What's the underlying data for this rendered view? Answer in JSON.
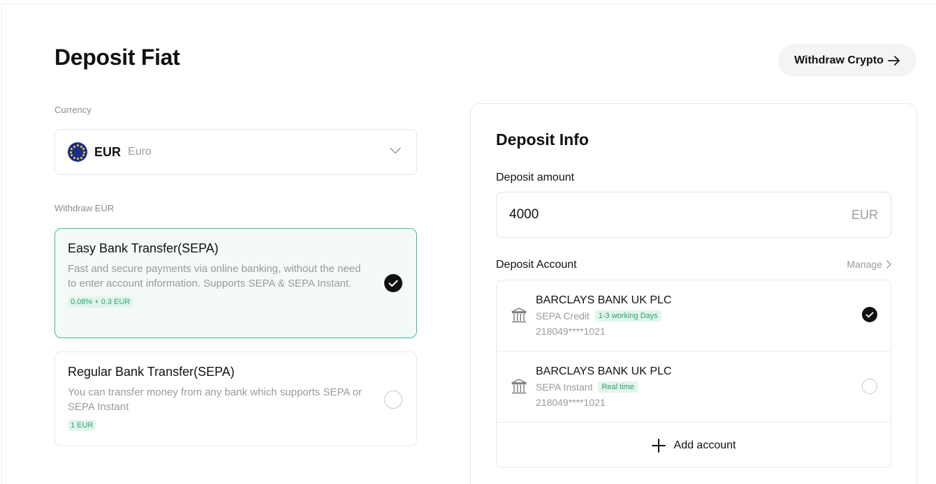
{
  "page": {
    "title": "Deposit Fiat",
    "withdraw_button": "Withdraw Crypto"
  },
  "currency": {
    "label": "Currency",
    "code": "EUR",
    "name": "Euro",
    "flag_icon": "eu-flag-icon"
  },
  "methods": {
    "label": "Withdraw EUR",
    "items": [
      {
        "title": "Easy  Bank Transfer(SEPA)",
        "description": "Fast and secure payments via online banking, without the need to enter account information. Supports SEPA & SEPA Instant.",
        "fee": "0.08% + 0.3  EUR",
        "selected": true
      },
      {
        "title": "Regular Bank Transfer(SEPA)",
        "description": "You can transfer money from any  bank which supports SEPA or SEPA Instant",
        "fee": "1 EUR",
        "selected": false
      }
    ]
  },
  "deposit_info": {
    "title": "Deposit Info",
    "amount_label": "Deposit amount",
    "amount_value": "4000",
    "amount_unit": "EUR",
    "account_label": "Deposit Account",
    "manage_label": "Manage",
    "accounts": [
      {
        "bank": "BARCLAYS BANK UK PLC",
        "type": "SEPA Credit",
        "tag": "1-3 working Days",
        "number": "218049****1021",
        "selected": true
      },
      {
        "bank": "BARCLAYS BANK UK PLC",
        "type": "SEPA Instant",
        "tag": "Real time",
        "number": "218049****1021",
        "selected": false
      }
    ],
    "add_account_label": "Add account"
  },
  "colors": {
    "accent_green": "#25a36f",
    "selected_border": "#3fbf8a",
    "selected_bg": "#f3faf7",
    "eu_blue": "#1d2c8f"
  }
}
